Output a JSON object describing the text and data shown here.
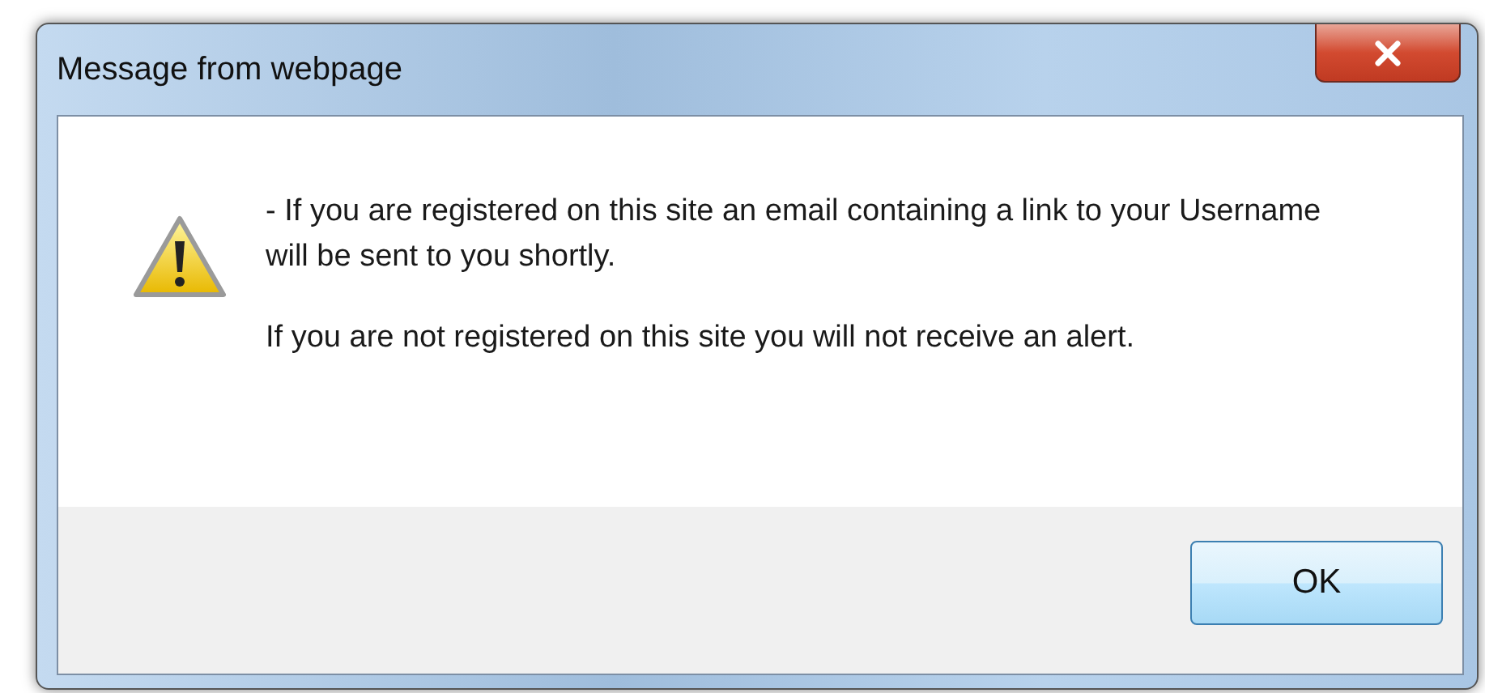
{
  "window": {
    "title": "Message from webpage"
  },
  "message": {
    "lines": [
      "- If you are registered on this site an email containing a link to your Username will be sent to you shortly.",
      "If you are not registered on this site you will not receive an alert."
    ]
  },
  "buttons": [
    "OK"
  ]
}
